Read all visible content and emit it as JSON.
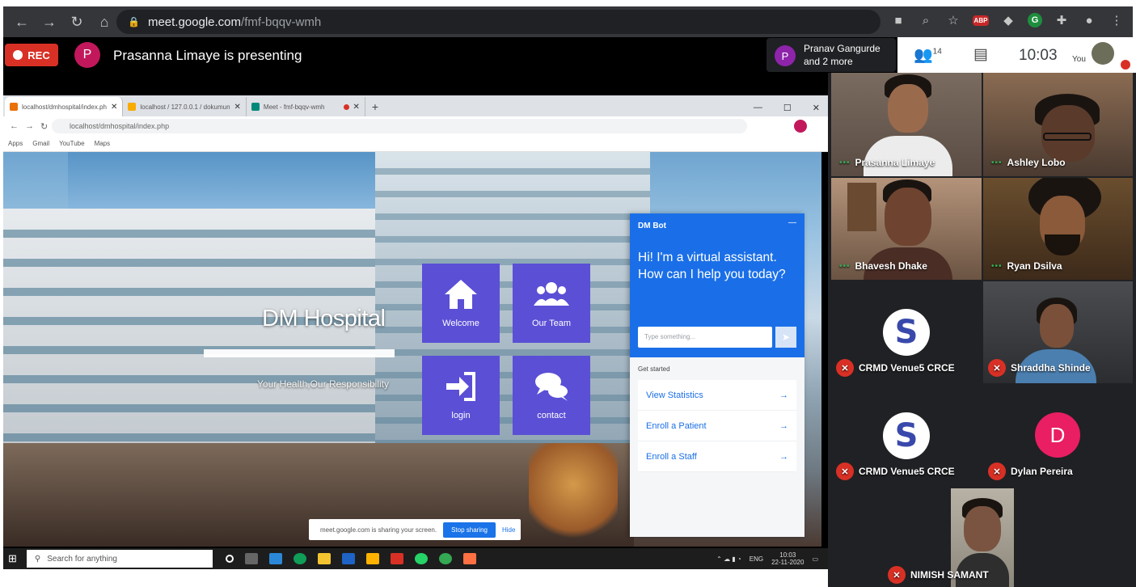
{
  "browser": {
    "url_host": "meet.google.com",
    "url_path": "/fmf-bqqv-wmh",
    "ext_abp": "ABP",
    "ext_g": "G"
  },
  "meet": {
    "rec_label": "REC",
    "presenter_initial": "P",
    "presenting_text": "Prasanna Limaye is presenting",
    "pin_initial": "P",
    "pinned_line1": "Pranav Gangurde",
    "pinned_line2": "and 2 more",
    "participants_count": "14",
    "clock": "10:03",
    "you_label": "You"
  },
  "shared": {
    "tabs": [
      {
        "label": "localhost/dmhospital/index.ph",
        "color": "#e8710a"
      },
      {
        "label": "localhost / 127.0.0.1 / dokumun",
        "color": "#f9ab00"
      },
      {
        "label": "Meet - fmf-bqqv-wmh",
        "color": "#00897b"
      }
    ],
    "url": "localhost/dmhospital/index.php",
    "bookmarks": [
      "Apps",
      "Gmail",
      "YouTube",
      "Maps"
    ],
    "site": {
      "brand": "DM Hospital",
      "tagline": "Your Health,Our Responsibility",
      "tiles": [
        "Welcome",
        "Our Team",
        "login",
        "contact"
      ]
    },
    "bot": {
      "name": "DM Bot",
      "greeting": "Hi! I'm a virtual assistant. How can I help you today?",
      "input_placeholder": "Type something...",
      "get_started": "Get started",
      "options": [
        "View Statistics",
        "Enroll a Patient",
        "Enroll a Staff"
      ]
    },
    "share_bar": {
      "message": "meet.google.com is sharing your screen.",
      "stop": "Stop sharing",
      "hide": "Hide"
    },
    "taskbar": {
      "search": "Search for anything",
      "lang": "ENG",
      "time": "10:03",
      "date": "22-11-2020"
    }
  },
  "participants": [
    {
      "name": "Prasanna Limaye"
    },
    {
      "name": "Ashley Lobo"
    },
    {
      "name": "Bhavesh Dhake"
    },
    {
      "name": "Ryan Dsilva"
    },
    {
      "name": "CRMD Venue5 CRCE"
    },
    {
      "name": "Shraddha Shinde"
    },
    {
      "name": "CRMD Venue5 CRCE"
    },
    {
      "name": "Dylan Pereira",
      "initial": "D"
    },
    {
      "name": "NIMISH SAMANT"
    }
  ]
}
